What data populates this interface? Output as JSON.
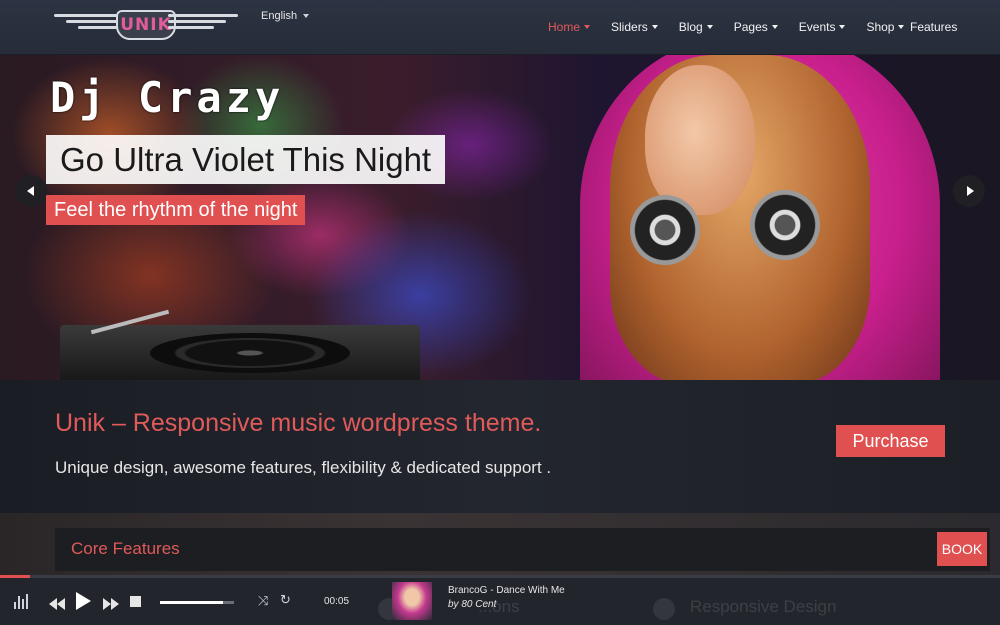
{
  "header": {
    "logo_text": "UNIK",
    "language": "English",
    "nav": [
      {
        "label": "Home",
        "has_dropdown": true,
        "active": true
      },
      {
        "label": "Sliders",
        "has_dropdown": true,
        "active": false
      },
      {
        "label": "Blog",
        "has_dropdown": true,
        "active": false
      },
      {
        "label": "Pages",
        "has_dropdown": true,
        "active": false
      },
      {
        "label": "Events",
        "has_dropdown": true,
        "active": false
      },
      {
        "label": "Shop",
        "has_dropdown": true,
        "active": false
      },
      {
        "label": "Features",
        "has_dropdown": false,
        "active": false
      }
    ]
  },
  "slider": {
    "title": "Dj Crazy",
    "caption_main": "Go Ultra Violet This Night",
    "caption_sub": "Feel the rhythm of the night"
  },
  "promo": {
    "title": "Unik – Responsive music wordpress theme.",
    "text": "Unique design, awesome features, flexibility & dedicated support .",
    "button": "Purchase"
  },
  "features": {
    "title": "Core Features",
    "book_button": "BOOK",
    "ghost_labels": [
      "...ons",
      "Responsive Design"
    ]
  },
  "player": {
    "time": "00:05",
    "track_title": "BrancoG - Dance With Me",
    "track_artist": "by 80 Cent",
    "progress": 0.03,
    "volume": 0.85
  },
  "colors": {
    "accent": "#e05050",
    "header_bg": "#2c3342",
    "dark_bg": "#1c1e22"
  }
}
